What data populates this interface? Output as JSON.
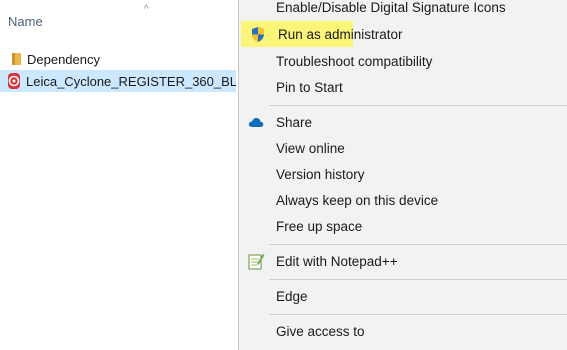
{
  "explorer": {
    "column_header": "Name",
    "sort_arrow": "^",
    "items": [
      {
        "name": "Dependency",
        "type": "folder"
      },
      {
        "name": "Leica_Cyclone_REGISTER_360_BL",
        "type": "application"
      }
    ]
  },
  "context_menu": {
    "items": [
      {
        "label": "Enable/Disable Digital Signature Icons",
        "icon": null
      },
      {
        "label": "Run as administrator",
        "icon": "shield-icon",
        "highlighted": true
      },
      {
        "label": "Troubleshoot compatibility",
        "icon": null
      },
      {
        "label": "Pin to Start",
        "icon": null
      },
      {
        "label": "Share",
        "icon": "onedrive-cloud-icon"
      },
      {
        "label": "View online",
        "icon": null
      },
      {
        "label": "Version history",
        "icon": null
      },
      {
        "label": "Always keep on this device",
        "icon": null
      },
      {
        "label": "Free up space",
        "icon": null
      },
      {
        "label": "Edit with Notepad++",
        "icon": "notepad-plus-plus-icon"
      },
      {
        "label": "Edge",
        "icon": null
      },
      {
        "label": "Give access to",
        "icon": null
      }
    ]
  },
  "colors": {
    "highlight": "#fbf67a",
    "selection": "#cce8ff",
    "menu_bg": "#f2f2f2"
  }
}
